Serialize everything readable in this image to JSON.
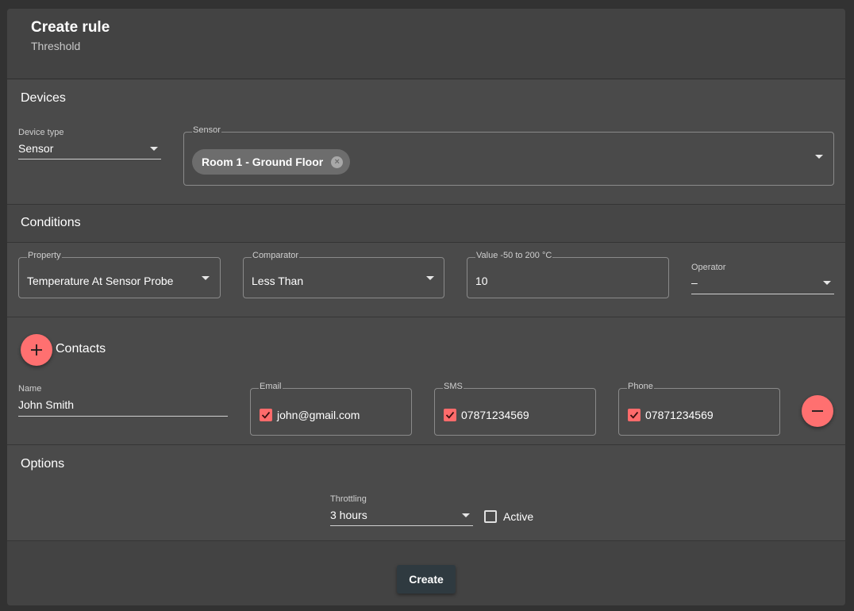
{
  "header": {
    "title": "Create rule",
    "subtitle": "Threshold"
  },
  "devices": {
    "title": "Devices",
    "device_type": {
      "label": "Device type",
      "value": "Sensor"
    },
    "sensor": {
      "label": "Sensor",
      "chip": "Room 1 - Ground Floor"
    }
  },
  "conditions": {
    "title": "Conditions",
    "property": {
      "label": "Property",
      "value": "Temperature At Sensor Probe"
    },
    "comparator": {
      "label": "Comparator",
      "value": "Less Than"
    },
    "value": {
      "label": "Value -50 to 200 °C",
      "value": "10"
    },
    "operator": {
      "label": "Operator",
      "value": "–"
    }
  },
  "contacts": {
    "title": "Contacts",
    "name": {
      "label": "Name",
      "value": "John Smith"
    },
    "email": {
      "label": "Email",
      "value": "john@gmail.com",
      "checked": true
    },
    "sms": {
      "label": "SMS",
      "value": "07871234569",
      "checked": true
    },
    "phone": {
      "label": "Phone",
      "value": "07871234569",
      "checked": true
    }
  },
  "options": {
    "title": "Options",
    "throttling": {
      "label": "Throttling",
      "value": "3 hours"
    },
    "active": {
      "label": "Active",
      "checked": false
    }
  },
  "footer": {
    "create_label": "Create"
  },
  "colors": {
    "accent": "#ff6b6b",
    "button": "#2f3a40",
    "background": "#464646"
  },
  "icons": [
    "add-icon",
    "remove-icon",
    "checkbox-checked-icon",
    "checkbox-unchecked-icon",
    "chip-remove-icon",
    "dropdown-arrow-icon"
  ]
}
